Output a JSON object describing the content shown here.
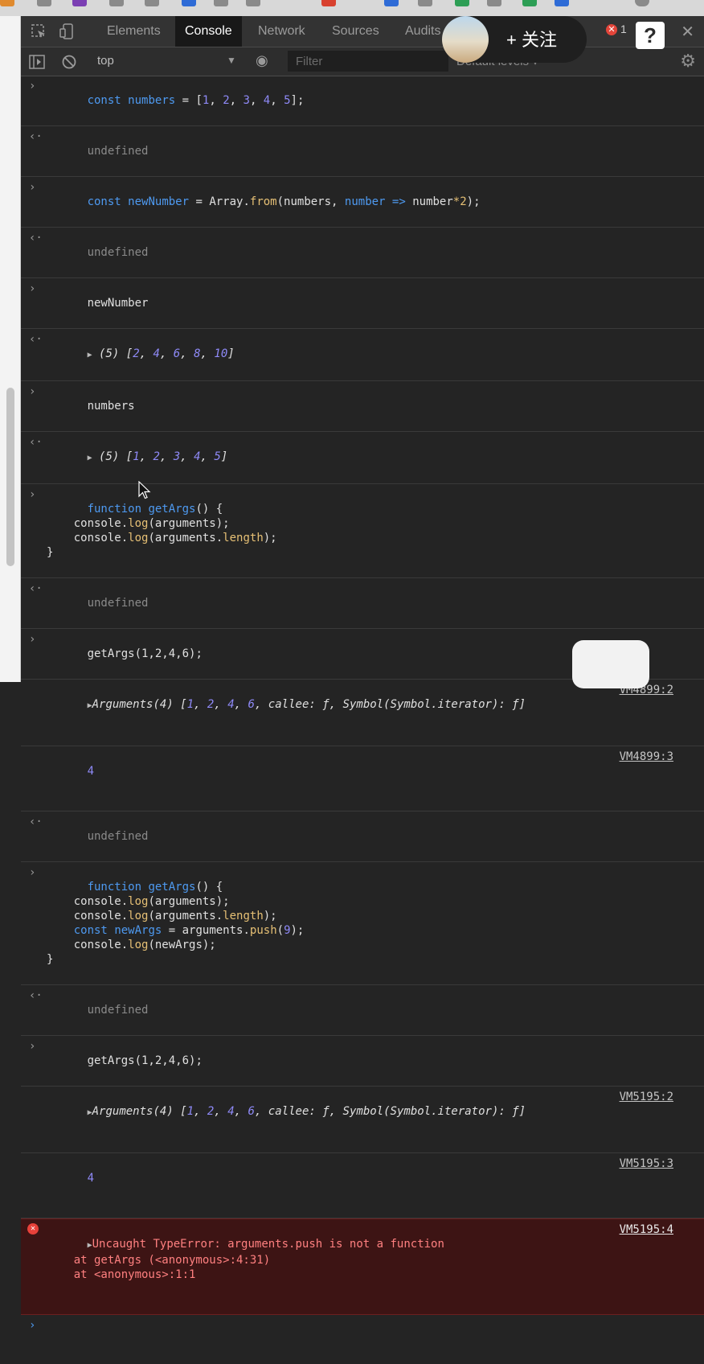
{
  "tabs": [
    {
      "label": "Elements"
    },
    {
      "label": "Console"
    },
    {
      "label": "Network"
    },
    {
      "label": "Sources"
    },
    {
      "label": "Audits"
    }
  ],
  "error_count": "1",
  "follow_overlay": {
    "label": "+ 关注"
  },
  "help_icon": "?",
  "context_selector": {
    "value": "top"
  },
  "filter": {
    "placeholder": "Filter"
  },
  "levels": {
    "label": "Default levels ▾"
  },
  "console": {
    "row1": {
      "code": "const numbers = [1, 2, 3, 4, 5];"
    },
    "row2": {
      "result": "undefined"
    },
    "row3": {
      "code": "const newNumber = Array.from(numbers, number => number*2);"
    },
    "row4": {
      "result": "undefined"
    },
    "row5": {
      "code": "newNumber"
    },
    "row6": {
      "result": "(5) [2, 4, 6, 8, 10]"
    },
    "row7": {
      "code": "numbers"
    },
    "row8": {
      "result": "(5) [1, 2, 3, 4, 5]"
    },
    "row9": {
      "code": "function getArgs() {\n    console.log(arguments);\n    console.log(arguments.length);\n}"
    },
    "row10": {
      "result": "undefined"
    },
    "row11": {
      "code": "getArgs(1,2,4,6);"
    },
    "row12": {
      "log": "Arguments(4) [1, 2, 4, 6, callee: ƒ, Symbol(Symbol.iterator): ƒ]",
      "source": "VM4899:2"
    },
    "row13": {
      "log": "4",
      "source": "VM4899:3"
    },
    "row14": {
      "result": "undefined"
    },
    "row15": {
      "code": "function getArgs() {\n    console.log(arguments);\n    console.log(arguments.length);\n    const newArgs = arguments.push(9);\n    console.log(newArgs);\n}"
    },
    "row16": {
      "result": "undefined"
    },
    "row17": {
      "code": "getArgs(1,2,4,6);"
    },
    "row18": {
      "log": "Arguments(4) [1, 2, 4, 6, callee: ƒ, Symbol(Symbol.iterator): ƒ]",
      "source": "VM5195:2"
    },
    "row19": {
      "log": "4",
      "source": "VM5195:3"
    },
    "row20": {
      "error": "Uncaught TypeError: arguments.push is not a function\n    at getArgs (<anonymous>:4:31)\n    at <anonymous>:1:1",
      "source": "VM5195:4"
    }
  },
  "colors": {
    "panel_bg": "#242424",
    "keyword": "#4e9af1",
    "number": "#8f8af8",
    "function": "#e6c075",
    "error_bg": "#3d1414",
    "error_text": "#ff8080"
  }
}
